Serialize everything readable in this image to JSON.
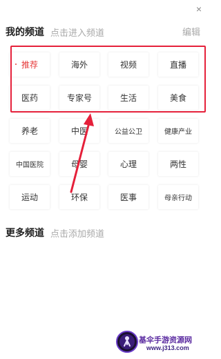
{
  "close_icon": "×",
  "my_channels": {
    "title": "我的频道",
    "hint": "点击进入频道",
    "edit_label": "编辑",
    "items": [
      "推荐",
      "海外",
      "视频",
      "直播",
      "医药",
      "专家号",
      "生活",
      "美食",
      "养老",
      "中医",
      "公益公卫",
      "健康产业",
      "中国医院",
      "母婴",
      "心理",
      "两性",
      "运动",
      "环保",
      "医事",
      "母亲行动"
    ],
    "active_item": "推荐"
  },
  "more_channels": {
    "title": "更多频道",
    "hint": "点击添加频道"
  },
  "annotation": {
    "color": "#e5203a"
  },
  "watermark": {
    "name": "基伞手游资源网",
    "url": "www.j313.com"
  },
  "colors": {
    "accent": "#e63c3c",
    "muted": "#a9a9a9",
    "annotation": "#e5203a"
  }
}
